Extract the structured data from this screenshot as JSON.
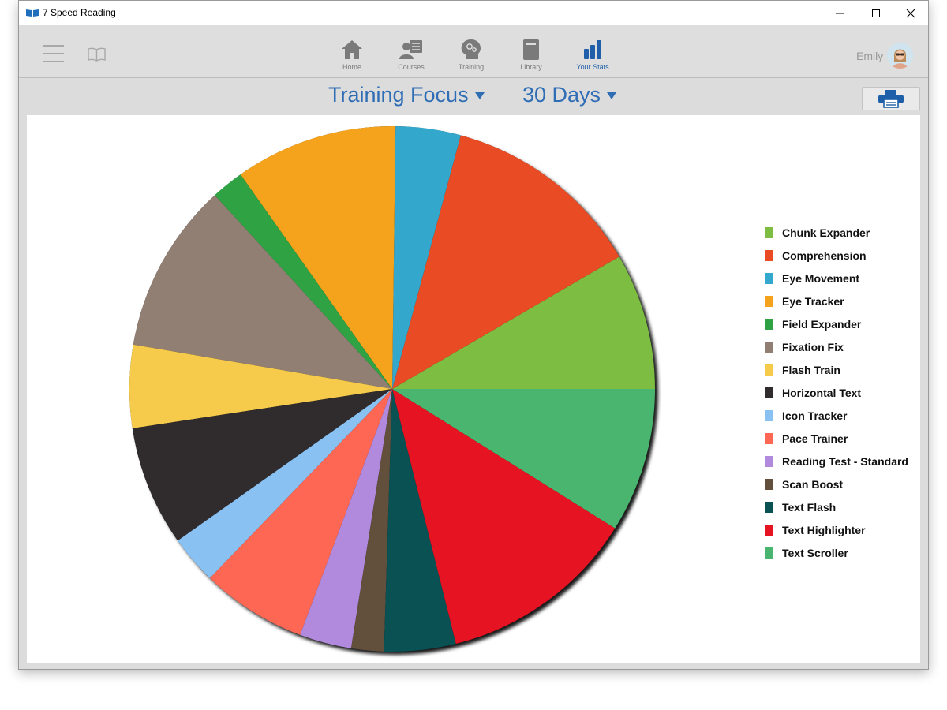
{
  "window": {
    "title": "7 Speed Reading"
  },
  "toolbar": {
    "nav": [
      {
        "label": "Home",
        "icon": "home-icon"
      },
      {
        "label": "Courses",
        "icon": "courses-icon"
      },
      {
        "label": "Training",
        "icon": "training-icon"
      },
      {
        "label": "Library",
        "icon": "library-icon"
      },
      {
        "label": "Your Stats",
        "icon": "stats-icon",
        "active": true
      }
    ],
    "user_name": "Emily"
  },
  "filters": {
    "focus_label": "Training Focus",
    "range_label": "30 Days"
  },
  "colors": {
    "accent": "#2f6db5",
    "nav_active": "#1f5ea8"
  },
  "chart_data": {
    "type": "pie",
    "legend_position": "right",
    "series": [
      {
        "name": "Chunk Expander",
        "value": 8.4,
        "color": "#7dbd42"
      },
      {
        "name": "Comprehension",
        "value": 12.4,
        "color": "#e94b24"
      },
      {
        "name": "Eye Movement",
        "value": 4.0,
        "color": "#34a8cc"
      },
      {
        "name": "Eye Tracker",
        "value": 10.0,
        "color": "#f5a31d"
      },
      {
        "name": "Field Expander",
        "value": 2.0,
        "color": "#2fa343"
      },
      {
        "name": "Fixation Fix",
        "value": 10.5,
        "color": "#927f74"
      },
      {
        "name": "Flash Train",
        "value": 5.1,
        "color": "#f6cb4b"
      },
      {
        "name": "Horizontal Text",
        "value": 7.4,
        "color": "#302b2c"
      },
      {
        "name": "Icon Tracker",
        "value": 3.0,
        "color": "#88c1f2"
      },
      {
        "name": "Pace Trainer",
        "value": 6.5,
        "color": "#fe6753"
      },
      {
        "name": "Reading Test - Standard",
        "value": 3.2,
        "color": "#b189dd"
      },
      {
        "name": "Scan Boost",
        "value": 2.0,
        "color": "#62503d"
      },
      {
        "name": "Text Flash",
        "value": 4.4,
        "color": "#0a5154"
      },
      {
        "name": "Text Highlighter",
        "value": 12.2,
        "color": "#e61322"
      },
      {
        "name": "Text Scroller",
        "value": 8.9,
        "color": "#4ab56f"
      }
    ]
  }
}
